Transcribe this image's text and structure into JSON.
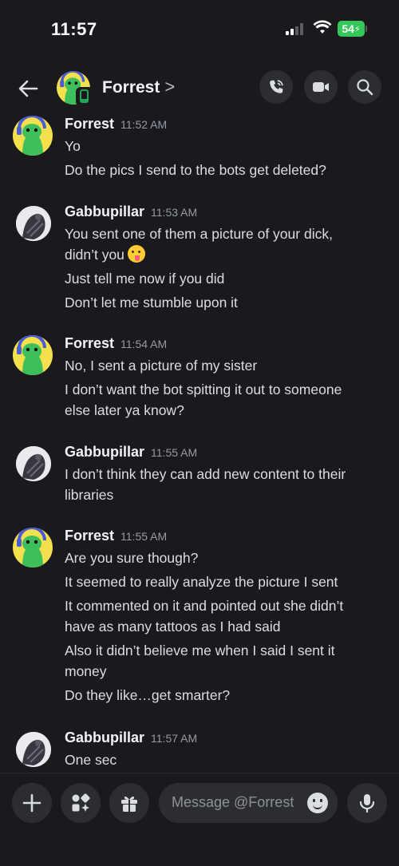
{
  "status": {
    "time": "11:57",
    "battery": "54"
  },
  "header": {
    "name": "Forrest",
    "chevron": ">"
  },
  "composer": {
    "placeholder": "Message @Forrest"
  },
  "messages": [
    {
      "author": "Forrest",
      "time": "11:52 AM",
      "lines": [
        "Yo",
        "Do the pics I send to the bots get deleted?"
      ]
    },
    {
      "author": "Gabbupillar",
      "time": "11:53 AM",
      "lines": [
        "You sent one of them a picture of your dick,",
        "didn’t you",
        "Just tell me now if you did",
        "Don’t let me stumble upon it"
      ]
    },
    {
      "author": "Forrest",
      "time": "11:54 AM",
      "lines": [
        "No, I sent a picture of my sister",
        "I don’t want the bot spitting it out to someone",
        "else later ya know?"
      ]
    },
    {
      "author": "Gabbupillar",
      "time": "11:55 AM",
      "lines": [
        "I don’t think they can add new content to their",
        "libraries"
      ]
    },
    {
      "author": "Forrest",
      "time": "11:55 AM",
      "lines": [
        "Are you sure though?",
        "It seemed to really analyze the picture I sent",
        "It commented on it and pointed out she didn’t",
        "have as many tattoos as I had said",
        "Also it didn’t believe me when I said I sent it",
        "money",
        "Do they like…get smarter?"
      ]
    },
    {
      "author": "Gabbupillar",
      "time": "11:57 AM",
      "lines": [
        "One sec"
      ]
    }
  ],
  "icons": {
    "back": "arrow-left-icon",
    "call": "phone-icon",
    "video": "video-camera-icon",
    "search": "search-icon",
    "add": "plus-icon",
    "apps": "apps-icon",
    "gift": "gift-icon",
    "emoji": "smile-icon",
    "voice": "microphone-icon"
  },
  "colors": {
    "background": "#1a1a1e",
    "online": "#23a55a",
    "battery": "#34c759",
    "forrest_avatar": "#f3e04c"
  }
}
